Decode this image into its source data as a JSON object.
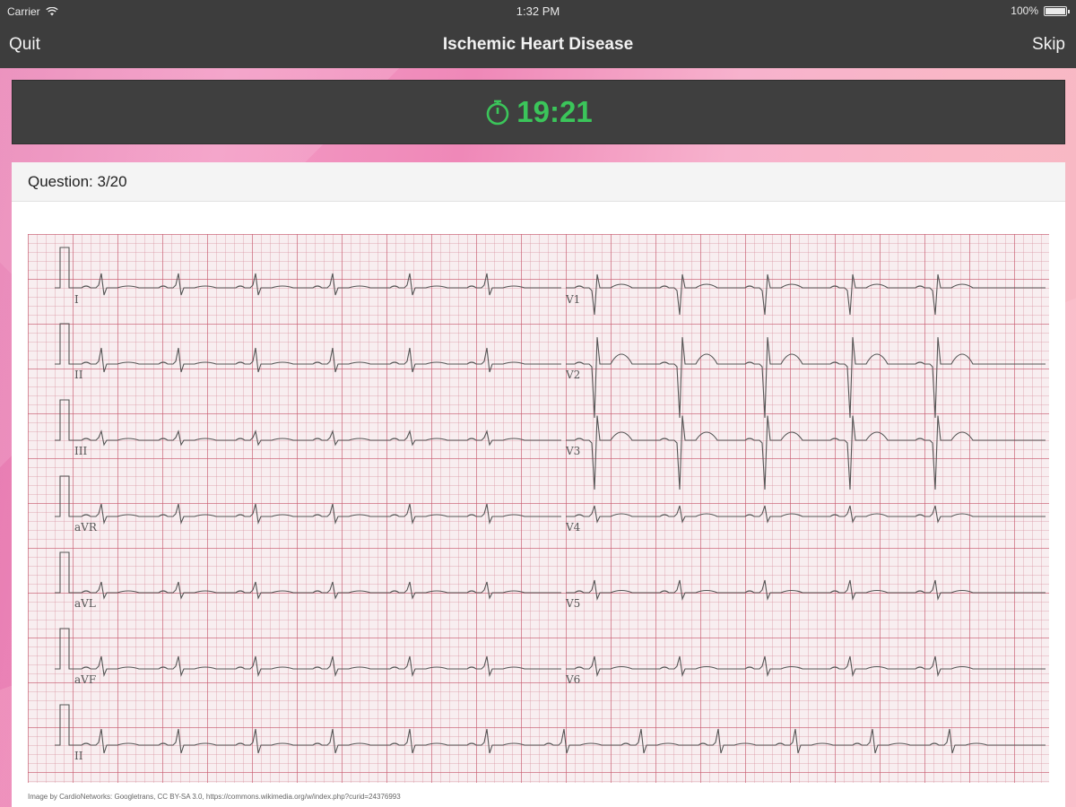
{
  "status": {
    "carrier": "Carrier",
    "time": "1:32 PM",
    "battery": "100%"
  },
  "nav": {
    "left": "Quit",
    "title": "Ischemic Heart Disease",
    "right": "Skip"
  },
  "timer": {
    "value": "19:21",
    "color": "#3bc55a"
  },
  "question": {
    "label": "Question: 3/20"
  },
  "ecg": {
    "leads_left": [
      "I",
      "II",
      "III",
      "aVR",
      "aVL",
      "aVF",
      "II"
    ],
    "leads_right": [
      "V1",
      "V2",
      "V3",
      "V4",
      "V5",
      "V6"
    ]
  },
  "credit": "Image by CardioNetworks: Googletrans, CC BY-SA 3.0, https://commons.wikimedia.org/w/index.php?curid=24376993"
}
